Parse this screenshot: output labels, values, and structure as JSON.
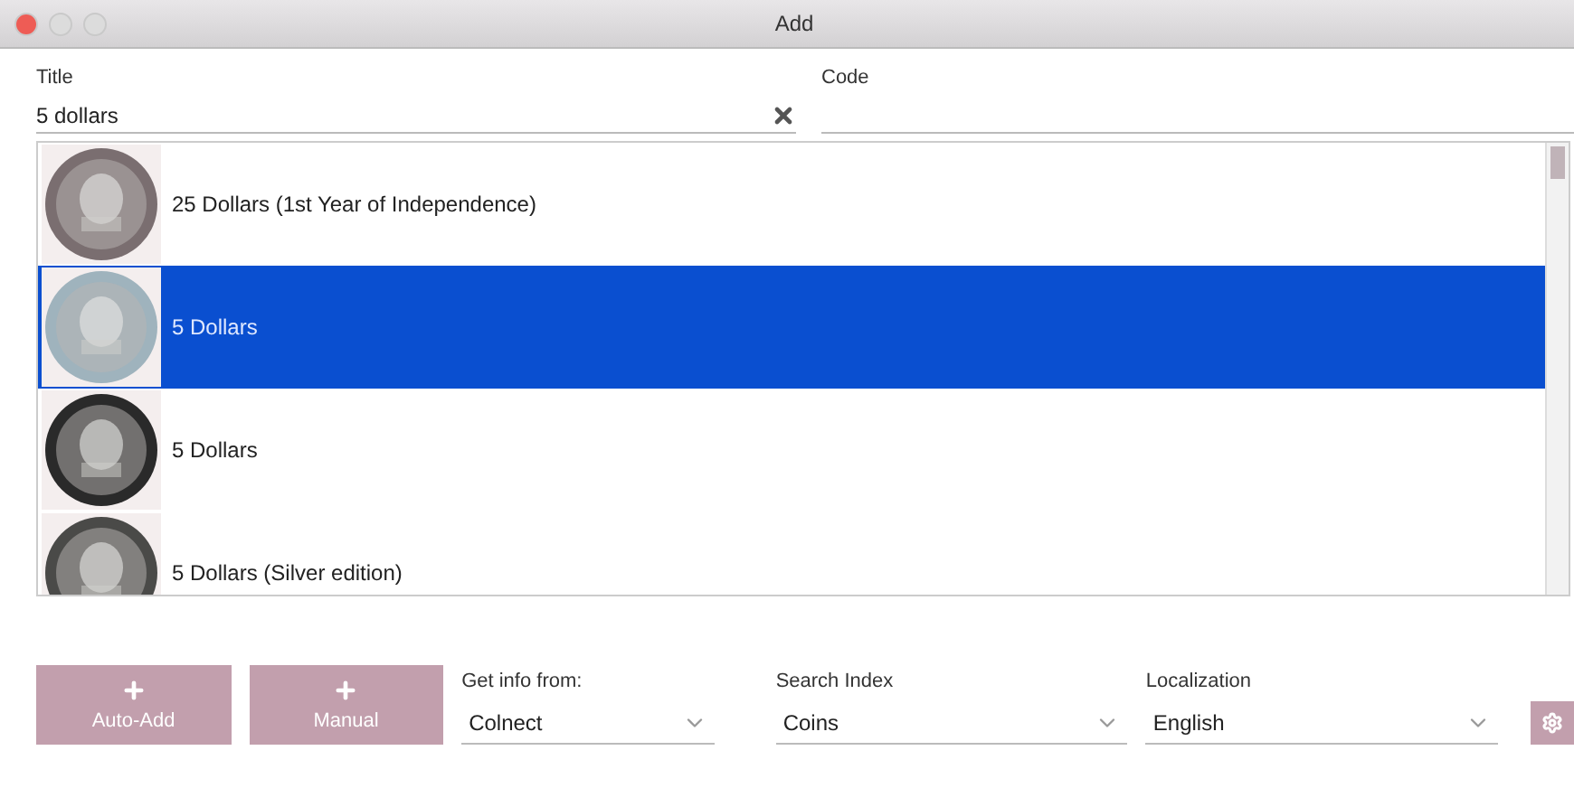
{
  "window": {
    "title": "Add"
  },
  "title_field": {
    "label": "Title",
    "value": "5 dollars"
  },
  "code_field": {
    "label": "Code"
  },
  "results": [
    {
      "name": "25 Dollars (1st Year of Independence)",
      "selected": false
    },
    {
      "name": "5 Dollars",
      "selected": true
    },
    {
      "name": "5 Dollars",
      "selected": false
    },
    {
      "name": "5 Dollars (Silver edition)",
      "selected": false
    }
  ],
  "buttons": [
    {
      "label": "Auto-Add"
    },
    {
      "label": "Manual"
    }
  ],
  "selects": [
    {
      "label": "Get info from:",
      "value": "Colnect"
    },
    {
      "label": "Search Index",
      "value": "Coins"
    },
    {
      "label": "Localization",
      "value": "English"
    }
  ]
}
